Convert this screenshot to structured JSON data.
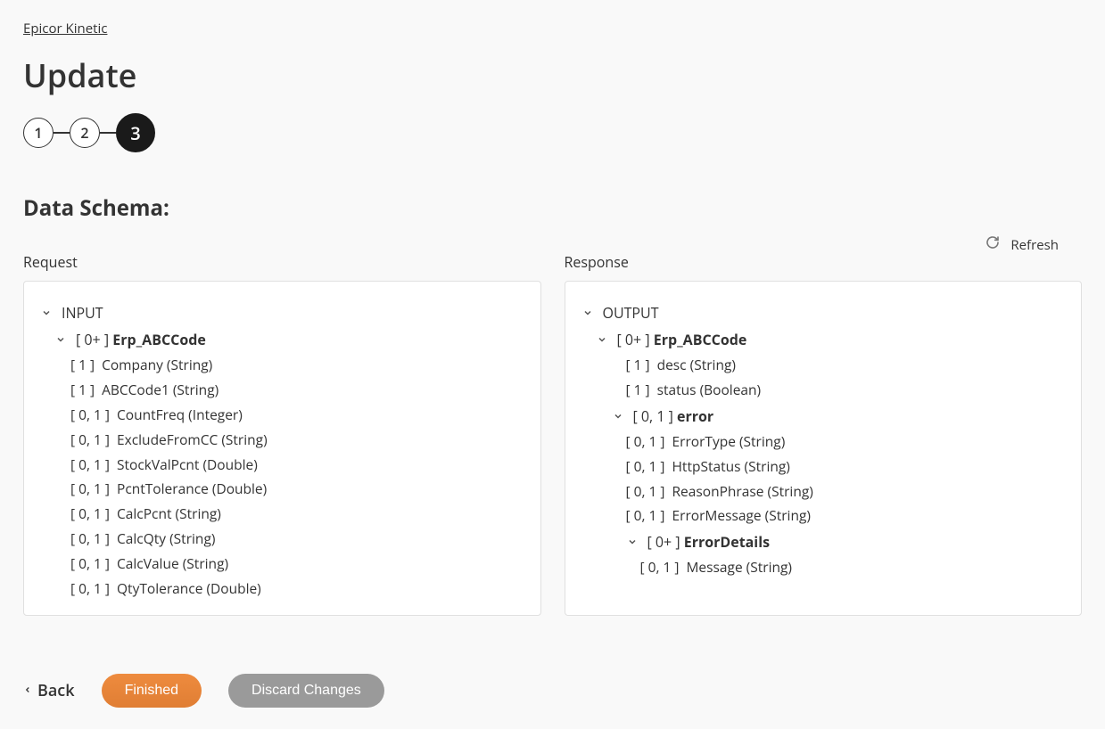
{
  "breadcrumb": "Epicor Kinetic",
  "title": "Update",
  "stepper": {
    "steps": [
      "1",
      "2",
      "3"
    ],
    "active_index": 2
  },
  "section_title": "Data Schema:",
  "refresh_label": "Refresh",
  "request_label": "Request",
  "response_label": "Response",
  "request_tree": {
    "root": "INPUT",
    "group": {
      "cardinality": "[ 0+ ]",
      "name": "Erp_ABCCode"
    },
    "fields": [
      {
        "cardinality": "[ 1 ]",
        "name": "Company",
        "type": "(String)"
      },
      {
        "cardinality": "[ 1 ]",
        "name": "ABCCode1",
        "type": "(String)"
      },
      {
        "cardinality": "[ 0, 1 ]",
        "name": "CountFreq",
        "type": "(Integer)"
      },
      {
        "cardinality": "[ 0, 1 ]",
        "name": "ExcludeFromCC",
        "type": "(String)"
      },
      {
        "cardinality": "[ 0, 1 ]",
        "name": "StockValPcnt",
        "type": "(Double)"
      },
      {
        "cardinality": "[ 0, 1 ]",
        "name": "PcntTolerance",
        "type": "(Double)"
      },
      {
        "cardinality": "[ 0, 1 ]",
        "name": "CalcPcnt",
        "type": "(String)"
      },
      {
        "cardinality": "[ 0, 1 ]",
        "name": "CalcQty",
        "type": "(String)"
      },
      {
        "cardinality": "[ 0, 1 ]",
        "name": "CalcValue",
        "type": "(String)"
      },
      {
        "cardinality": "[ 0, 1 ]",
        "name": "QtyTolerance",
        "type": "(Double)"
      }
    ]
  },
  "response_tree": {
    "root": "OUTPUT",
    "group": {
      "cardinality": "[ 0+ ]",
      "name": "Erp_ABCCode"
    },
    "fields1": [
      {
        "cardinality": "[ 1 ]",
        "name": "desc",
        "type": "(String)"
      },
      {
        "cardinality": "[ 1 ]",
        "name": "status",
        "type": "(Boolean)"
      }
    ],
    "error": {
      "cardinality": "[ 0, 1 ]",
      "name": "error"
    },
    "error_fields": [
      {
        "cardinality": "[ 0, 1 ]",
        "name": "ErrorType",
        "type": "(String)"
      },
      {
        "cardinality": "[ 0, 1 ]",
        "name": "HttpStatus",
        "type": "(String)"
      },
      {
        "cardinality": "[ 0, 1 ]",
        "name": "ReasonPhrase",
        "type": "(String)"
      },
      {
        "cardinality": "[ 0, 1 ]",
        "name": "ErrorMessage",
        "type": "(String)"
      }
    ],
    "error_details": {
      "cardinality": "[ 0+ ]",
      "name": "ErrorDetails"
    },
    "error_details_fields": [
      {
        "cardinality": "[ 0, 1 ]",
        "name": "Message",
        "type": "(String)"
      }
    ]
  },
  "footer": {
    "back": "Back",
    "finished": "Finished",
    "discard": "Discard Changes"
  }
}
